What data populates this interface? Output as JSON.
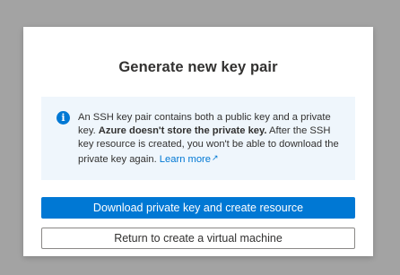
{
  "dialog": {
    "title": "Generate new key pair",
    "info": {
      "icon": "info-icon",
      "text_part1": "An SSH key pair contains both a public key and a private key. ",
      "text_bold": "Azure doesn't store the private key.",
      "text_part2": " After the SSH key resource is created, you won't be able to download the private key again. ",
      "link_label": "Learn more",
      "link_icon": "external-link-icon"
    },
    "primary_button_label": "Download private key and create resource",
    "secondary_button_label": "Return to create a virtual machine"
  },
  "colors": {
    "accent": "#0078d4",
    "info_background": "#eff6fc",
    "overlay": "#a3a3a3"
  }
}
